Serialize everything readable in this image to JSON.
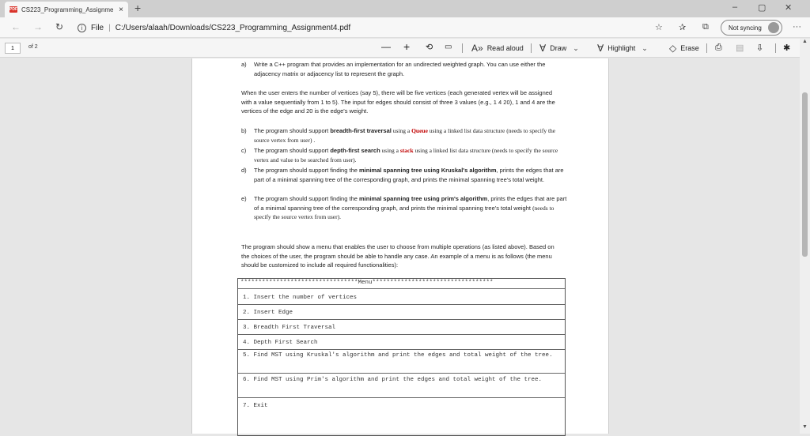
{
  "browser": {
    "tab_title": "CS223_Programming_Assignme",
    "tab_badge": "PDF",
    "tab_close": "×",
    "new_tab": "+",
    "win_minimize": "–",
    "win_restore": "▢",
    "win_close": "✕",
    "back": "←",
    "forward": "→",
    "refresh": "↻",
    "url_scheme": "File",
    "url": "C:/Users/alaah/Downloads/CS223_Programming_Assignment4.pdf",
    "sync_label": "Not syncing",
    "more": "···"
  },
  "pdf_toolbar": {
    "page_number": "1",
    "page_of": "of 2",
    "zoom_out": "—",
    "zoom_in": "+",
    "read_aloud": "Read aloud",
    "draw": "Draw",
    "highlight": "Highlight",
    "erase": "Erase"
  },
  "document": {
    "a_label": "a)",
    "a_text": "Write a C++ program that provides an implementation for an undirected weighted graph. You can use either the adjacency matrix or adjacency list to represent the graph.",
    "p1": "When the user enters the number of vertices (say 5), there will be five vertices (each generated vertex will be assigned with a value sequentially from 1 to 5). The input for edges should consist of three 3 values (e.g., 1 4 20), 1 and 4 are the vertices of the edge and 20 is the edge's weight.",
    "b_label": "b)",
    "b_pre": "The program should support ",
    "b_bold": "breadth-first traversal",
    "b_mid": " using a ",
    "b_red": "Queue",
    "b_post": " using a linked list data structure (needs to specify the source vertex from user) .",
    "c_label": "c)",
    "c_pre": "The program should support ",
    "c_bold": "depth-first search",
    "c_mid": " using a ",
    "c_red": "stack",
    "c_post": " using a linked list data structure (needs to specify the source vertex and value to be searched from user).",
    "d_label": "d)",
    "d_pre": "The program should support finding the ",
    "d_bold": "minimal spanning tree using Kruskal's algorithm",
    "d_post": ", prints the edges that are part of a minimal spanning tree of the corresponding graph, and prints the minimal spanning tree's total weight.",
    "e_label": "e)",
    "e_pre": "The program should support finding the ",
    "e_bold": "minimal spanning tree using prim's algorithm",
    "e_post": ", prints the edges that are part of a minimal spanning tree of the corresponding graph, and prints the minimal spanning tree's total weight ",
    "e_serif": "(needs to specify the source vertex from user).",
    "p2": "The program should show a menu that enables the user to choose from multiple operations (as listed above). Based on the choices of the user, the program should be able to handle any case. An example of a menu is as follows (the menu should be customized to include all required functionalities):",
    "menu_header": "*********************************Menu**********************************",
    "menu_items": [
      "1. Insert the number of vertices",
      "2. Insert Edge",
      "3. Breadth First Traversal",
      "4. Depth First Search",
      "5. Find MST using Kruskal's algorithm and print the edges and total weight of the tree.",
      "6. Find MST using Prim's algorithm and print the edges and total weight of the tree.",
      "7. Exit"
    ]
  }
}
